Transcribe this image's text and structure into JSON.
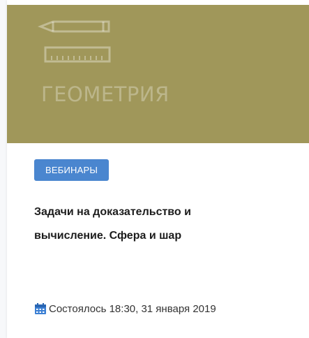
{
  "banner": {
    "title": "ГЕОМЕТРИЯ",
    "background_color": "#a0975a",
    "icon": "pencil-ruler-icon"
  },
  "badge": {
    "label": "ВЕБИНАРЫ",
    "color": "#4a86cf"
  },
  "card": {
    "title_line1": "Задачи на доказательство и",
    "title_line2": "вычисление. Сфера и шар"
  },
  "status": {
    "icon": "calendar-icon",
    "text": "Состоялось 18:30, 31 января 2019"
  }
}
